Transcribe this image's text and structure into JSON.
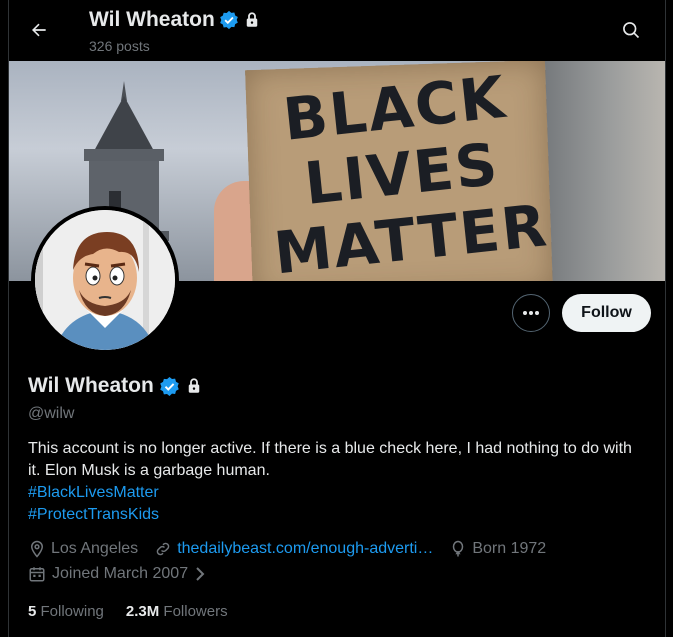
{
  "header": {
    "name": "Wil Wheaton",
    "posts": "326 posts"
  },
  "banner": {
    "sign_lines": [
      "BLACK",
      "LIVES",
      "MATTER"
    ]
  },
  "actions": {
    "follow_label": "Follow"
  },
  "profile": {
    "name": "Wil Wheaton",
    "handle": "@wilw",
    "bio_text": "This account is no longer active. If there is a blue check here, I had nothing to do with it. Elon Musk is a garbage human.",
    "hashtags": [
      "#BlackLivesMatter",
      "#ProtectTransKids"
    ],
    "location": "Los Angeles",
    "website": "thedailybeast.com/enough-adverti…",
    "born": "Born 1972",
    "joined": "Joined March 2007",
    "following_count": "5",
    "following_label": "Following",
    "followers_count": "2.3M",
    "followers_label": "Followers"
  },
  "colors": {
    "accent": "#1d9bf0",
    "verified": "#1d9bf0",
    "background": "#000000",
    "muted_text": "#71767b"
  },
  "icons": {
    "back": "arrow-left-icon",
    "search": "search-icon",
    "verified": "verified-badge-icon",
    "protected": "lock-icon",
    "more": "more-icon",
    "location": "location-pin-icon",
    "link": "link-icon",
    "born": "balloon-icon",
    "joined": "calendar-icon"
  }
}
